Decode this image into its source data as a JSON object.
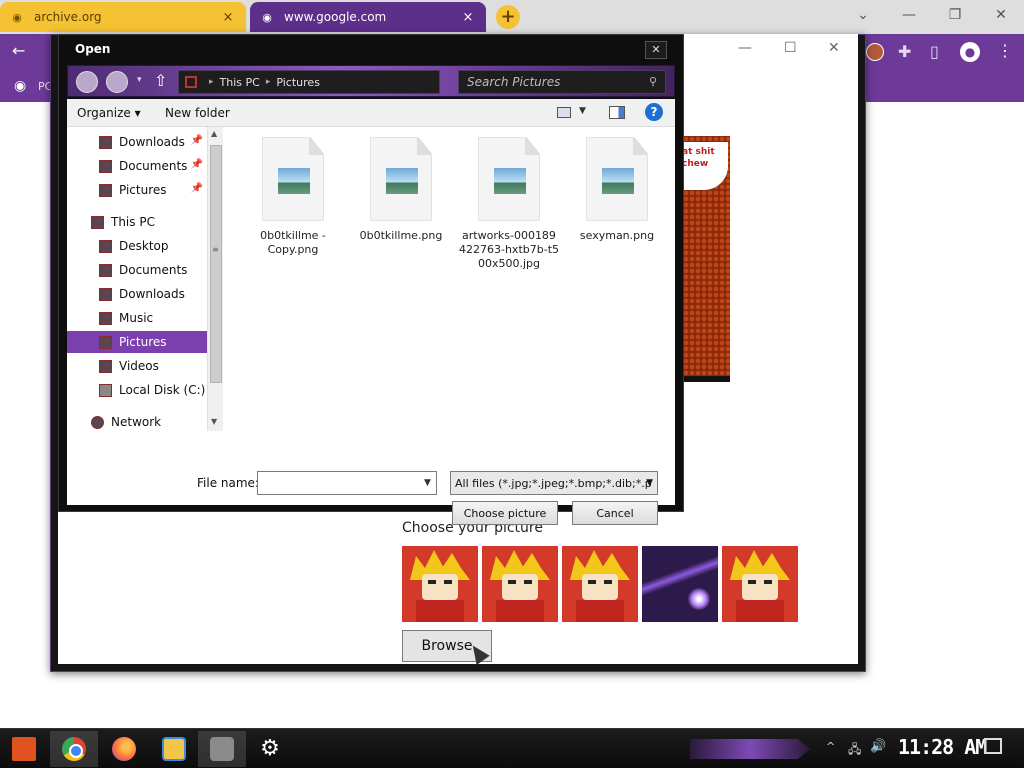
{
  "browser": {
    "tabs": [
      {
        "title": "archive.org",
        "close": "×"
      },
      {
        "title": "www.google.com",
        "close": "×"
      }
    ],
    "new_tab": "+",
    "bookmark_text": "PC",
    "window_controls": {
      "minimize": "—",
      "restore": "❐",
      "close": "✕"
    },
    "chevron": "⌄",
    "colors": {
      "tab_active": "#5d2f8a",
      "tab_other": "#f5c234",
      "toolbar": "#6e3a9a"
    }
  },
  "page": {
    "choose_label": "Choose your picture",
    "browse_label": "Browse",
    "meme_text": "at shit chew",
    "popup_controls": {
      "minimize": "—",
      "maximize": "☐",
      "close": "✕"
    }
  },
  "dialog": {
    "title": "Open",
    "close": "✕",
    "breadcrumb": [
      "This PC",
      "Pictures"
    ],
    "breadcrumb_sep": "▸",
    "search_placeholder": "Search Pictures",
    "commands": {
      "organize": "Organize ▾",
      "new_folder": "New folder",
      "help": "?"
    },
    "nav_items": [
      {
        "label": "Downloads",
        "pinned": true,
        "selected": false
      },
      {
        "label": "Documents",
        "pinned": true,
        "selected": false
      },
      {
        "label": "Pictures",
        "pinned": true,
        "selected": false
      },
      {
        "label": "This PC",
        "pinned": false,
        "selected": false
      },
      {
        "label": "Desktop",
        "pinned": false,
        "selected": false
      },
      {
        "label": "Documents",
        "pinned": false,
        "selected": false
      },
      {
        "label": "Downloads",
        "pinned": false,
        "selected": false
      },
      {
        "label": "Music",
        "pinned": false,
        "selected": false
      },
      {
        "label": "Pictures",
        "pinned": false,
        "selected": true
      },
      {
        "label": "Videos",
        "pinned": false,
        "selected": false
      },
      {
        "label": "Local Disk (C:)",
        "pinned": false,
        "selected": false
      },
      {
        "label": "Network",
        "pinned": false,
        "selected": false
      }
    ],
    "pin_glyph": "📌",
    "files": [
      {
        "name": "0b0tkillme - Copy.png"
      },
      {
        "name": "0b0tkillme.png"
      },
      {
        "name": "artworks-000189422763-hxtb7b-t500x500.jpg"
      },
      {
        "name": "sexyman.png"
      }
    ],
    "file_name_label": "File name:",
    "file_name_value": "",
    "filter": "All files (*.jpg;*.jpeg;*.bmp;*.dib;*.p",
    "buttons": {
      "choose": "Choose picture",
      "cancel": "Cancel"
    },
    "selection_color": "#7b3fae"
  },
  "taskbar": {
    "clock": "11:28 AM",
    "settings_glyph": "⚙",
    "tray": {
      "chevron": "^",
      "network": "🖧",
      "volume": "🔊"
    }
  }
}
